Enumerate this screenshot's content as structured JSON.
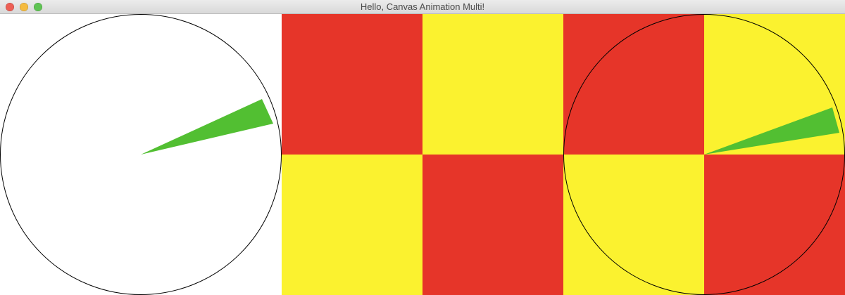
{
  "window": {
    "title": "Hello, Canvas Animation Multi!",
    "buttons": {
      "close_color": "#ed5f55",
      "minimize_color": "#f5bb3f",
      "maximize_color": "#5fc453"
    }
  },
  "colors": {
    "checker_red": "#e63529",
    "checker_yellow": "#fbf22f",
    "wedge_green": "#52bf32",
    "circle_stroke": "#000000",
    "background": "#ffffff"
  },
  "canvases": [
    {
      "name": "spinner",
      "background": "white",
      "circle": true,
      "wedge": true
    },
    {
      "name": "checkerboard",
      "background": "checker",
      "circle": false,
      "wedge": false
    },
    {
      "name": "spinner-on-checkerboard",
      "background": "checker",
      "circle": true,
      "wedge": true
    }
  ]
}
